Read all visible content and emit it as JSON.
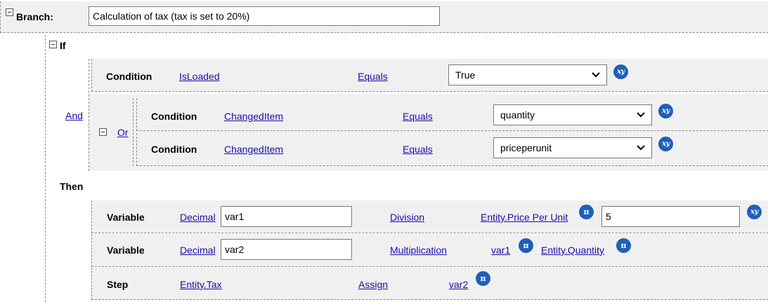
{
  "branch": {
    "label": "Branch:",
    "description": "Calculation of  tax (tax is set to 20%)"
  },
  "if_block": {
    "label": "If",
    "and_label": "And",
    "or_label": "Or",
    "conditions": [
      {
        "label": "Condition",
        "field": "IsLoaded",
        "operator": "Equals",
        "value": "True"
      },
      {
        "label": "Condition",
        "field": "ChangedItem",
        "operator": "Equals",
        "value": "quantity"
      },
      {
        "label": "Condition",
        "field": "ChangedItem",
        "operator": "Equals",
        "value": "priceperunit"
      }
    ]
  },
  "then_block": {
    "label": "Then",
    "rows": [
      {
        "label": "Variable",
        "type": "Decimal",
        "name": "var1",
        "operation": "Division",
        "operand1": "Entity.Price Per Unit",
        "operand2": "5"
      },
      {
        "label": "Variable",
        "type": "Decimal",
        "name": "var2",
        "operation": "Multiplication",
        "operand1": "var1",
        "operand2": "Entity.Quantity"
      },
      {
        "label": "Step",
        "target": "Entity.Tax",
        "operation": "Assign",
        "operand1": "var2"
      }
    ]
  },
  "icons": {
    "pi_glyph": "π",
    "xy_glyph": "xy",
    "accent": "#1f5fb8"
  }
}
